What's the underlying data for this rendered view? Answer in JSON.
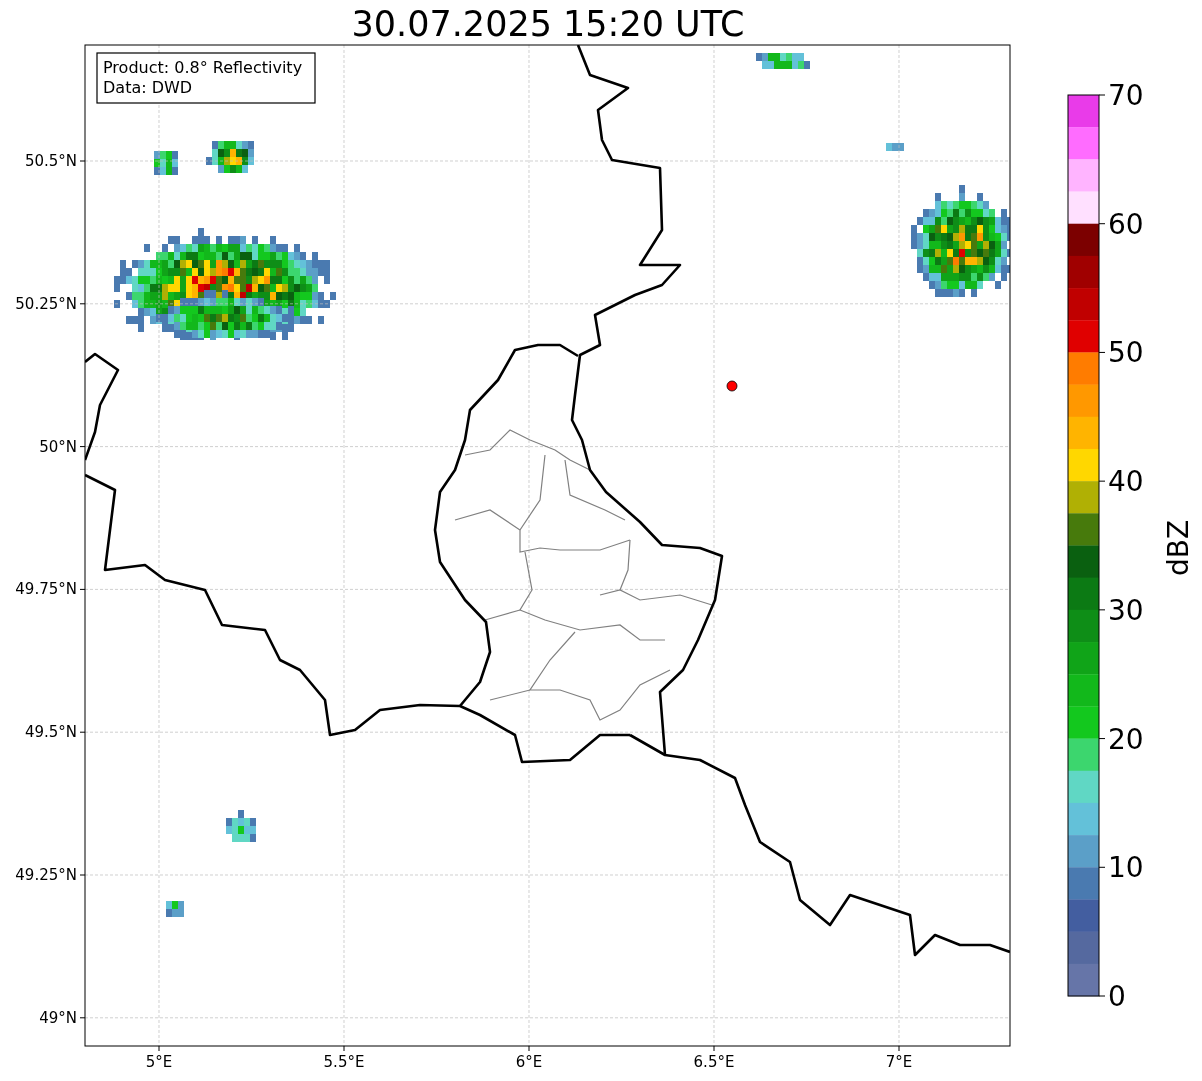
{
  "title": "30.07.2025 15:20 UTC",
  "info_box": [
    "Product: 0.8° Reflectivity",
    "Data: DWD"
  ],
  "map": {
    "xticks": [
      "5°E",
      "5.5°E",
      "6°E",
      "6.5°E",
      "7°E"
    ],
    "yticks": [
      "50.5°N",
      "50.25°N",
      "50°N",
      "49.75°N",
      "49.5°N",
      "49.25°N",
      "49°N"
    ]
  },
  "colorbar": {
    "label": "dBZ",
    "ticks": [
      "70",
      "60",
      "50",
      "40",
      "30",
      "20",
      "10",
      "0"
    ],
    "segments": [
      {
        "color": "#e93be9"
      },
      {
        "color": "#ff6cff"
      },
      {
        "color": "#ffb4ff"
      },
      {
        "color": "#ffe0ff"
      },
      {
        "color": "#7c0000"
      },
      {
        "color": "#a00000"
      },
      {
        "color": "#c00000"
      },
      {
        "color": "#e00000"
      },
      {
        "color": "#ff7c00"
      },
      {
        "color": "#ff9800"
      },
      {
        "color": "#ffb400"
      },
      {
        "color": "#ffd700"
      },
      {
        "color": "#b0b004"
      },
      {
        "color": "#477a0c"
      },
      {
        "color": "#0a6010"
      },
      {
        "color": "#0c7a14"
      },
      {
        "color": "#0e8e17"
      },
      {
        "color": "#10a418"
      },
      {
        "color": "#12b81b"
      },
      {
        "color": "#13c81e"
      },
      {
        "color": "#3cd66e"
      },
      {
        "color": "#60d7c4"
      },
      {
        "color": "#63c1d9"
      },
      {
        "color": "#5b9fc8"
      },
      {
        "color": "#4a7ab0"
      },
      {
        "color": "#435ea0"
      },
      {
        "color": "#55699f"
      },
      {
        "color": "#6675a8"
      }
    ]
  }
}
